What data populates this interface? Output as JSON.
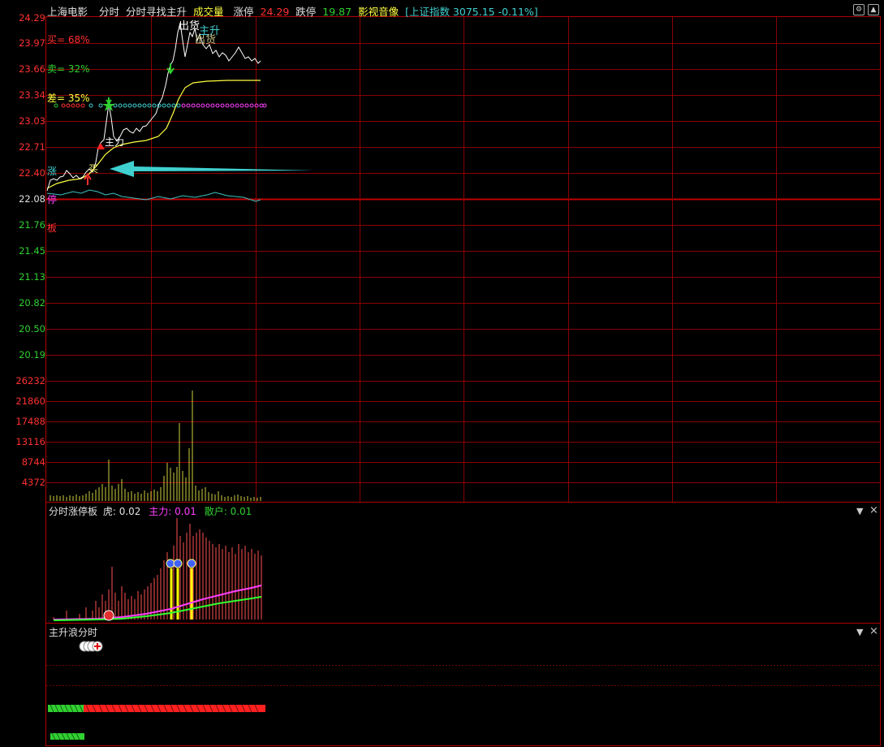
{
  "header": {
    "stock_name": "上海电影",
    "tab_intraday": "分时",
    "indicator_name": "分时寻找主升",
    "volume_label": "成交量",
    "limit_up_label": "涨停",
    "limit_up_value": "24.29",
    "limit_down_label": "跌停",
    "limit_down_value": "19.87",
    "sector_name": "影视音像",
    "index_text": "[上证指数 3075.15 -0.11%]"
  },
  "price_axis": [
    "24.29",
    "23.97",
    "23.66",
    "23.34",
    "23.03",
    "22.71",
    "22.40",
    "22.08",
    "21.76",
    "21.45",
    "21.13",
    "20.82",
    "20.50",
    "20.19"
  ],
  "volume_axis": [
    "26232",
    "21860",
    "17488",
    "13116",
    "8744",
    "4372"
  ],
  "price_panel": {
    "buy_ratio": "买= 68%",
    "sell_ratio": "卖= 32%",
    "diff_ratio": "差= 35%",
    "side_zhang": "涨",
    "side_ting": "停",
    "side_ban": "板",
    "label_zhuli": "主力",
    "label_mai": "买",
    "label_chuhuo_top": "出货",
    "label_zhusheng": "主升",
    "label_chuhuo": "出货"
  },
  "panel2": {
    "title": "分时涨停板",
    "hu_label": "虎:",
    "hu_value": "0.02",
    "zhuli_label": "主力:",
    "zhuli_value": "0.01",
    "sanhu_label": "散户:",
    "sanhu_value": "0.01"
  },
  "panel3": {
    "title": "主升浪分时"
  },
  "controls": {
    "dropdown_glyph": "▼",
    "close_glyph": "×",
    "settings_glyph": "⚙"
  },
  "colors": {
    "grid": "#8b0000",
    "price_line": "#ffffff",
    "avg_line": "#ffff40",
    "up": "#ff3030",
    "down": "#30d030",
    "cyan": "#40d0d0",
    "magenta": "#ff40ff"
  }
}
